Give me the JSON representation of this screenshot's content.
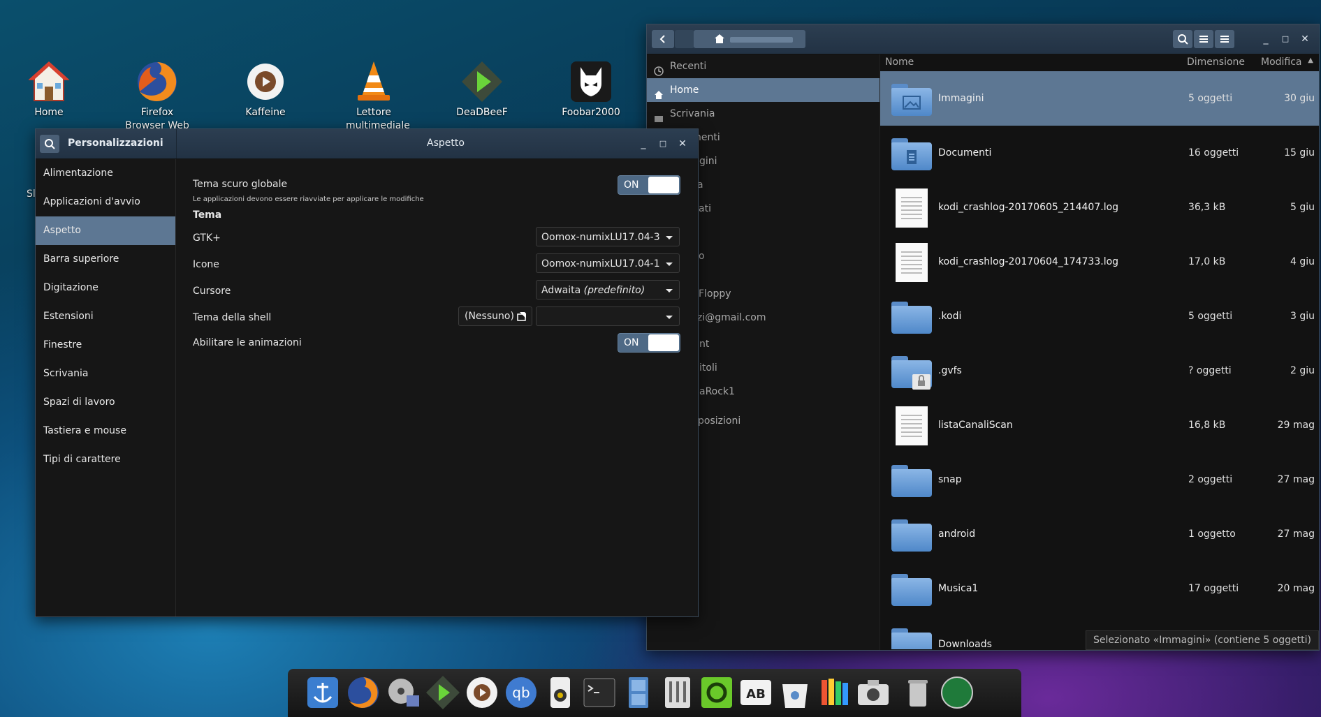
{
  "desktop": {
    "icons": [
      {
        "label": "Home"
      },
      {
        "label": "Firefox Browser Web"
      },
      {
        "label": "Kaffeine"
      },
      {
        "label": "Lettore multimediale"
      },
      {
        "label": "DeaDBeeF"
      },
      {
        "label": "Foobar2000"
      }
    ],
    "partial_label": "Sl"
  },
  "settings": {
    "app_title": "Personalizzazioni",
    "page_title": "Aspetto",
    "sidebar": [
      "Alimentazione",
      "Applicazioni d'avvio",
      "Aspetto",
      "Barra superiore",
      "Digitazione",
      "Estensioni",
      "Finestre",
      "Scrivania",
      "Spazi di lavoro",
      "Tastiera e mouse",
      "Tipi di carattere"
    ],
    "selected_index": 2,
    "dark_theme": {
      "label": "Tema scuro globale",
      "note": "Le applicazioni devono essere riavviate per applicare le modifiche",
      "toggle": "ON"
    },
    "theme_heading": "Tema",
    "gtk": {
      "label": "GTK+",
      "value": "Oomox-numixLU17.04-3"
    },
    "icons": {
      "label": "Icone",
      "value": "Oomox-numixLU17.04-1"
    },
    "cursor": {
      "label": "Cursore",
      "value": "Adwaita",
      "value_suffix": "(predefinito)"
    },
    "shell_theme": {
      "label": "Tema della shell",
      "button": "(Nessuno)",
      "value": ""
    },
    "animations": {
      "label": "Abilitare le animazioni",
      "toggle": "ON"
    }
  },
  "files": {
    "columns": {
      "name": "Nome",
      "size": "Dimensione",
      "modified": "Modifica"
    },
    "sidebar": [
      {
        "label": "Recenti",
        "icon": "clock-icon"
      },
      {
        "label": "Home",
        "icon": "home-icon"
      },
      {
        "label": "Scrivania",
        "icon": "folder-icon"
      },
      {
        "label": "nenti",
        "icon": ""
      },
      {
        "label": "gini",
        "icon": ""
      },
      {
        "label": "a",
        "icon": ""
      },
      {
        "label": "ati",
        "icon": ""
      },
      {
        "label": "",
        "icon": ""
      },
      {
        "label": "o",
        "icon": ""
      },
      {
        "label": "",
        "icon": ""
      },
      {
        "label": "Floppy",
        "icon": ""
      },
      {
        "label": "zi@gmail.com",
        "icon": ""
      },
      {
        "label": "",
        "icon": ""
      },
      {
        "label": "nt",
        "icon": ""
      },
      {
        "label": "itoli",
        "icon": ""
      },
      {
        "label": "aRock1",
        "icon": ""
      },
      {
        "label": "",
        "icon": ""
      },
      {
        "label": "posizioni",
        "icon": ""
      }
    ],
    "rows": [
      {
        "name": "Immagini",
        "size": "5 oggetti",
        "date": "30 giu",
        "type": "folder-pictures"
      },
      {
        "name": "Documenti",
        "size": "16 oggetti",
        "date": "15 giu",
        "type": "folder-documents"
      },
      {
        "name": "kodi_crashlog-20170605_214407.log",
        "size": "36,3 kB",
        "date": "5 giu",
        "type": "file"
      },
      {
        "name": "kodi_crashlog-20170604_174733.log",
        "size": "17,0 kB",
        "date": "4 giu",
        "type": "file"
      },
      {
        "name": ".kodi",
        "size": "5 oggetti",
        "date": "3 giu",
        "type": "folder"
      },
      {
        "name": ".gvfs",
        "size": "? oggetti",
        "date": "2 giu",
        "type": "folder-locked"
      },
      {
        "name": "listaCanaliScan",
        "size": "16,8 kB",
        "date": "29 mag",
        "type": "file"
      },
      {
        "name": "snap",
        "size": "2 oggetti",
        "date": "27 mag",
        "type": "folder"
      },
      {
        "name": "android",
        "size": "1 oggetto",
        "date": "27 mag",
        "type": "folder"
      },
      {
        "name": "Musica1",
        "size": "17 oggetti",
        "date": "20 mag",
        "type": "folder"
      },
      {
        "name": "Downloads",
        "size": "",
        "date": "",
        "type": "folder"
      }
    ],
    "status": "Selezionato «Immagini» (contiene 5 oggetti)"
  },
  "colors": {
    "accent": "#5d7793",
    "titlebar": "#26374a",
    "toggle": "#4e6985"
  }
}
